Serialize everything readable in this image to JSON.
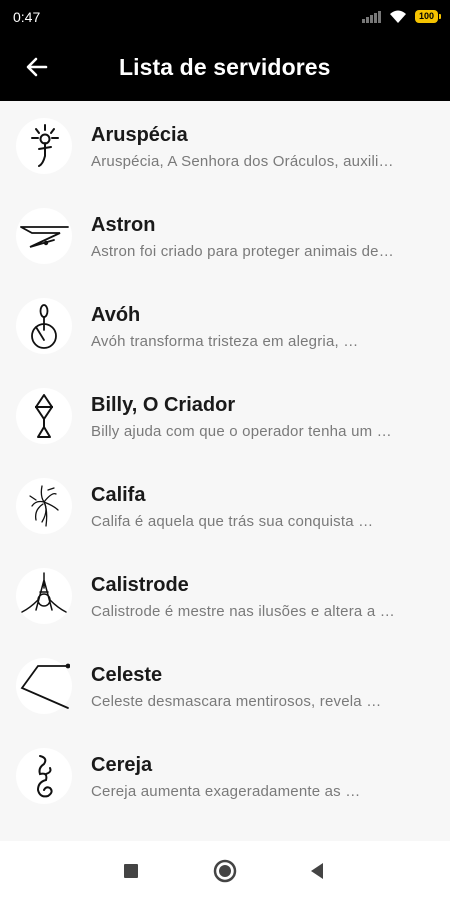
{
  "status_bar": {
    "time": "0:47",
    "battery": "100"
  },
  "app_bar": {
    "title": "Lista de servidores"
  },
  "servers": [
    {
      "name": "Aruspécia",
      "description": "Aruspécia, A Senhora dos Oráculos, auxili…",
      "icon": "sun-figure-sigil-icon"
    },
    {
      "name": "Astron",
      "description": "Astron foi criado para proteger animais de…",
      "icon": "zigzag-sigil-icon"
    },
    {
      "name": "Avóh",
      "description": "Avóh transforma tristeza em alegria, …",
      "icon": "circle-loop-sigil-icon"
    },
    {
      "name": "Billy, O Criador",
      "description": "Billy ajuda com que o operador tenha um …",
      "icon": "diamond-triangle-sigil-icon"
    },
    {
      "name": "Califa",
      "description": "Califa é aquela que trás sua conquista …",
      "icon": "spider-sigil-icon"
    },
    {
      "name": "Calistrode",
      "description": "Calistrode é mestre nas ilusões e altera a …",
      "icon": "compass-sigil-icon"
    },
    {
      "name": "Celeste",
      "description": "Celeste desmascara mentirosos, revela …",
      "icon": "angle-line-sigil-icon"
    },
    {
      "name": "Cereja",
      "description": "Cereja aumenta exageradamente as …",
      "icon": "spiral-sigil-icon"
    }
  ],
  "nav_bar": {
    "recents": "square-icon",
    "home": "circle-icon",
    "back": "triangle-back-icon"
  }
}
